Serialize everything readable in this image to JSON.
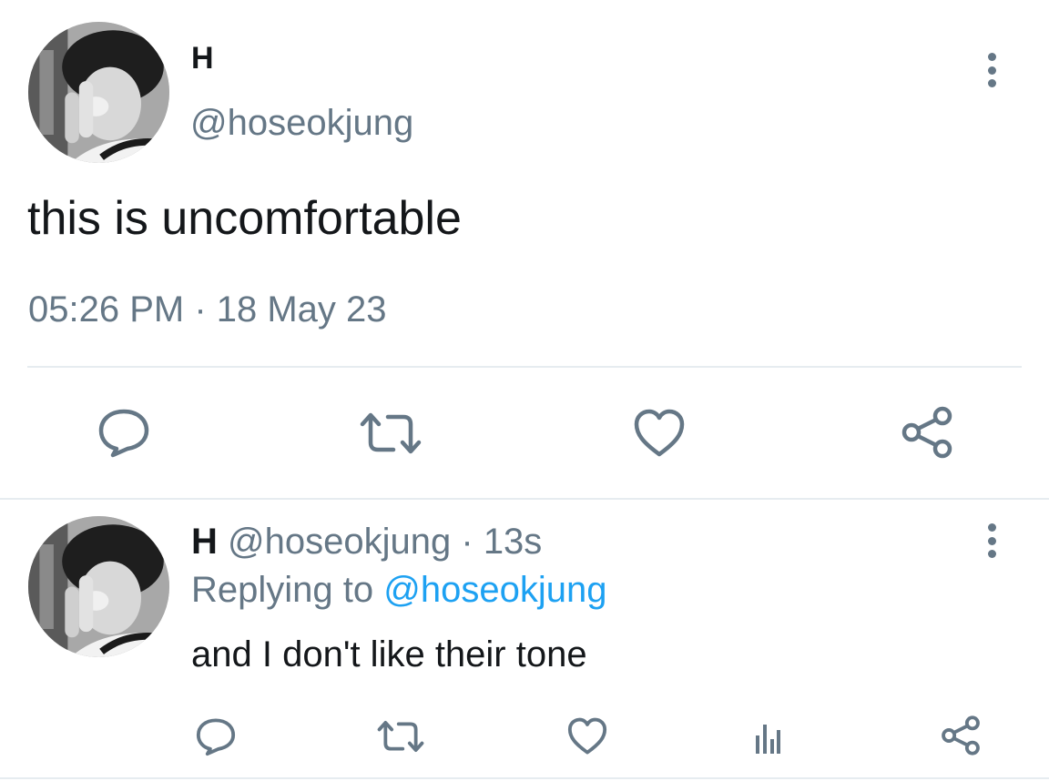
{
  "colors": {
    "text": "#14171a",
    "muted": "#657786",
    "link": "#1da1f2",
    "divider": "#e6ecf0"
  },
  "main_tweet": {
    "display_name": "H",
    "handle": "@hoseokjung",
    "text": "this is uncomfortable",
    "timestamp": "05:26 PM · 18 May 23",
    "avatar": "profile-photo-grayscale",
    "actions": [
      "reply-icon",
      "retweet-icon",
      "like-icon",
      "share-icon"
    ]
  },
  "reply": {
    "display_name": "H",
    "handle": "@hoseokjung",
    "separator": "·",
    "time": "13s",
    "replying_label": "Replying to",
    "replying_handle": "@hoseokjung",
    "text": "and I don't like their tone",
    "avatar": "profile-photo-grayscale",
    "actions": [
      "reply-icon",
      "retweet-icon",
      "like-icon",
      "analytics-icon",
      "share-icon"
    ]
  }
}
